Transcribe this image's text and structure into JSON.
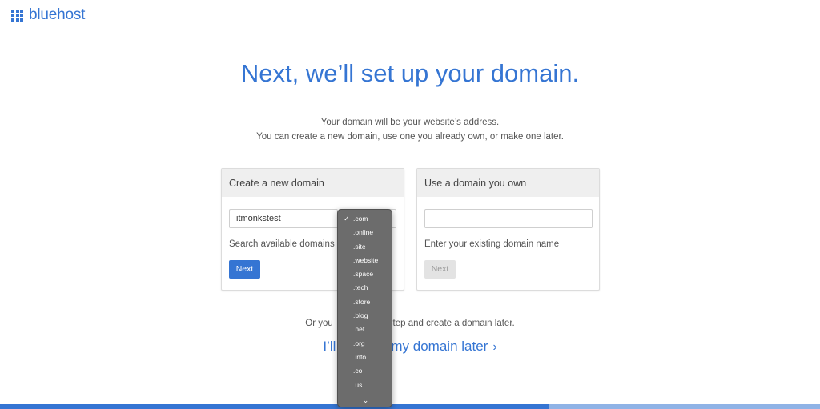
{
  "brand": {
    "name": "bluehost",
    "color": "#3575d3"
  },
  "headline": "Next, we’ll set up your domain.",
  "subtitle": {
    "line1": "Your domain will be your website’s address.",
    "line2": "You can create a new domain, use one you already own, or make one later."
  },
  "new_domain_card": {
    "title": "Create a new domain",
    "input_value": "itmonkstest",
    "hint": "Search available domains",
    "button_label": "Next"
  },
  "own_domain_card": {
    "title": "Use a domain you own",
    "input_value": "",
    "hint": "Enter your existing domain name",
    "button_label": "Next"
  },
  "skip": {
    "text_visible_left": "Or you",
    "text_visible_right": "step and create a domain later.",
    "link_visible_left": "I’ll",
    "link_visible_right": "my domain later"
  },
  "tld_dropdown": {
    "selected": ".com",
    "options": [
      ".com",
      ".online",
      ".site",
      ".website",
      ".space",
      ".tech",
      ".store",
      ".blog",
      ".net",
      ".org",
      ".info",
      ".co",
      ".us"
    ],
    "check_icon": "checkmark-icon",
    "more_icon": "chevron-down-icon"
  }
}
